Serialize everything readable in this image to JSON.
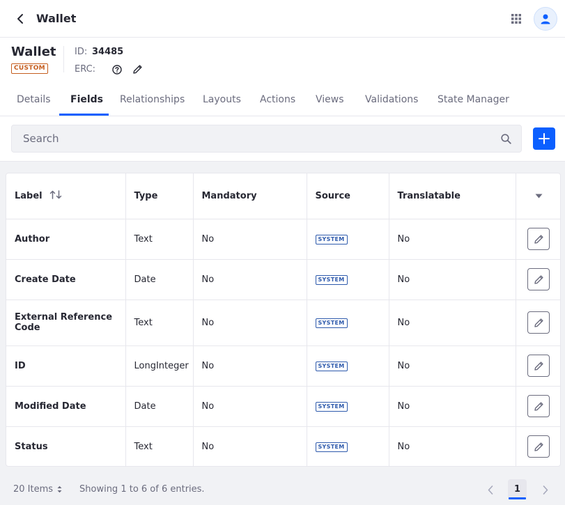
{
  "topbar": {
    "title": "Wallet"
  },
  "header": {
    "object_title": "Wallet",
    "badge": "CUSTOM",
    "id_label": "ID:",
    "id_value": "34485",
    "erc_label": "ERC:"
  },
  "tabs": [
    {
      "label": "Details",
      "active": false
    },
    {
      "label": "Fields",
      "active": true
    },
    {
      "label": "Relationships",
      "active": false
    },
    {
      "label": "Layouts",
      "active": false
    },
    {
      "label": "Actions",
      "active": false
    },
    {
      "label": "Views",
      "active": false
    },
    {
      "label": "Validations",
      "active": false
    },
    {
      "label": "State Manager",
      "active": false
    }
  ],
  "search": {
    "placeholder": "Search"
  },
  "table": {
    "columns": [
      "Label",
      "Type",
      "Mandatory",
      "Source",
      "Translatable"
    ],
    "rows": [
      {
        "label": "Author",
        "type": "Text",
        "mandatory": "No",
        "source": "SYSTEM",
        "translatable": "No"
      },
      {
        "label": "Create Date",
        "type": "Date",
        "mandatory": "No",
        "source": "SYSTEM",
        "translatable": "No"
      },
      {
        "label": "External Reference Code",
        "type": "Text",
        "mandatory": "No",
        "source": "SYSTEM",
        "translatable": "No"
      },
      {
        "label": "ID",
        "type": "LongInteger",
        "mandatory": "No",
        "source": "SYSTEM",
        "translatable": "No"
      },
      {
        "label": "Modified Date",
        "type": "Date",
        "mandatory": "No",
        "source": "SYSTEM",
        "translatable": "No"
      },
      {
        "label": "Status",
        "type": "Text",
        "mandatory": "No",
        "source": "SYSTEM",
        "translatable": "No"
      }
    ]
  },
  "footer": {
    "items_per_page": "20 Items",
    "showing": "Showing 1 to 6 of 6 entries.",
    "current_page": "1"
  },
  "colors": {
    "accent": "#0b5fff",
    "custom_badge": "#c55d1e",
    "system_badge": "#2e5aac"
  },
  "icons": [
    "back-arrow-icon",
    "apps-grid-icon",
    "user-icon",
    "help-icon",
    "pencil-icon",
    "search-icon",
    "plus-icon",
    "sort-icon",
    "caret-down-icon",
    "chevron-left-icon",
    "chevron-right-icon"
  ]
}
